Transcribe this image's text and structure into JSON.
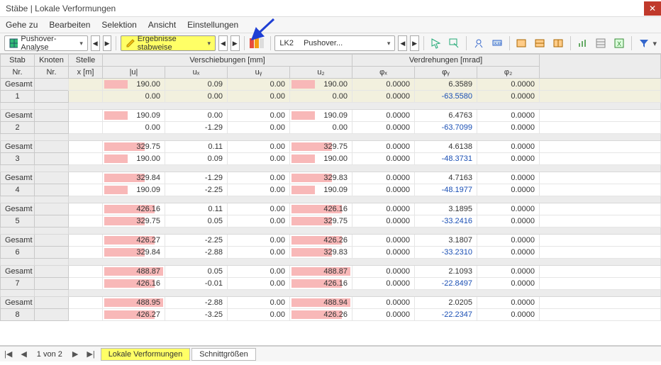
{
  "window": {
    "title": "Stäbe | Lokale Verformungen"
  },
  "menu": {
    "items": [
      "Gehe zu",
      "Bearbeiten",
      "Selektion",
      "Ansicht",
      "Einstellungen"
    ]
  },
  "toolbar": {
    "analysis": "Pushover-Analyse",
    "results": "Ergebnisse stabweise",
    "lc_code": "LK2",
    "lc_name": "Pushover..."
  },
  "headers": {
    "stab": "Stab",
    "nr": "Nr.",
    "knoten": "Knoten",
    "stelle": "Stelle",
    "x": "x [m]",
    "versch": "Verschiebungen [mm]",
    "verdr": "Verdrehungen [mrad]",
    "u": "|u|",
    "ux": "uₓ",
    "uy": "uᵧ",
    "uz": "u₂",
    "phix": "φₓ",
    "phiy": "φᵧ",
    "phiz": "φ₂"
  },
  "labels": {
    "gesamt": "Gesamt"
  },
  "rows": [
    {
      "id": "1",
      "g": {
        "u": "190.00",
        "ux": "0.09",
        "uy": "0.00",
        "uz": "190.00",
        "px": "0.0000",
        "py": "6.3589",
        "pz": "0.0000",
        "bu": 38,
        "bz": 38
      },
      "r": {
        "u": "0.00",
        "ux": "0.00",
        "uy": "0.00",
        "uz": "0.00",
        "px": "0.0000",
        "py": "-63.5580",
        "pz": "0.0000",
        "bu": 0,
        "bz": 0
      }
    },
    {
      "id": "2",
      "g": {
        "u": "190.09",
        "ux": "0.00",
        "uy": "0.00",
        "uz": "190.09",
        "px": "0.0000",
        "py": "6.4763",
        "pz": "0.0000",
        "bu": 38,
        "bz": 38
      },
      "r": {
        "u": "0.00",
        "ux": "-1.29",
        "uy": "0.00",
        "uz": "0.00",
        "px": "0.0000",
        "py": "-63.7099",
        "pz": "0.0000",
        "bu": 0,
        "bz": 0
      }
    },
    {
      "id": "3",
      "g": {
        "u": "329.75",
        "ux": "0.11",
        "uy": "0.00",
        "uz": "329.75",
        "px": "0.0000",
        "py": "4.6138",
        "pz": "0.0000",
        "bu": 65,
        "bz": 65
      },
      "r": {
        "u": "190.00",
        "ux": "0.09",
        "uy": "0.00",
        "uz": "190.00",
        "px": "0.0000",
        "py": "-48.3731",
        "pz": "0.0000",
        "bu": 38,
        "bz": 38
      }
    },
    {
      "id": "4",
      "g": {
        "u": "329.84",
        "ux": "-1.29",
        "uy": "0.00",
        "uz": "329.83",
        "px": "0.0000",
        "py": "4.7163",
        "pz": "0.0000",
        "bu": 65,
        "bz": 65
      },
      "r": {
        "u": "190.09",
        "ux": "-2.25",
        "uy": "0.00",
        "uz": "190.09",
        "px": "0.0000",
        "py": "-48.1977",
        "pz": "0.0000",
        "bu": 38,
        "bz": 38
      }
    },
    {
      "id": "5",
      "g": {
        "u": "426.16",
        "ux": "0.11",
        "uy": "0.00",
        "uz": "426.16",
        "px": "0.0000",
        "py": "3.1895",
        "pz": "0.0000",
        "bu": 82,
        "bz": 82
      },
      "r": {
        "u": "329.75",
        "ux": "0.05",
        "uy": "0.00",
        "uz": "329.75",
        "px": "0.0000",
        "py": "-33.2416",
        "pz": "0.0000",
        "bu": 65,
        "bz": 65
      }
    },
    {
      "id": "6",
      "g": {
        "u": "426.27",
        "ux": "-2.25",
        "uy": "0.00",
        "uz": "426.26",
        "px": "0.0000",
        "py": "3.1807",
        "pz": "0.0000",
        "bu": 82,
        "bz": 82
      },
      "r": {
        "u": "329.84",
        "ux": "-2.88",
        "uy": "0.00",
        "uz": "329.83",
        "px": "0.0000",
        "py": "-33.2310",
        "pz": "0.0000",
        "bu": 65,
        "bz": 65
      }
    },
    {
      "id": "7",
      "g": {
        "u": "488.87",
        "ux": "0.05",
        "uy": "0.00",
        "uz": "488.87",
        "px": "0.0000",
        "py": "2.1093",
        "pz": "0.0000",
        "bu": 95,
        "bz": 95
      },
      "r": {
        "u": "426.16",
        "ux": "-0.01",
        "uy": "0.00",
        "uz": "426.16",
        "px": "0.0000",
        "py": "-22.8497",
        "pz": "0.0000",
        "bu": 82,
        "bz": 82
      }
    },
    {
      "id": "8",
      "g": {
        "u": "488.95",
        "ux": "-2.88",
        "uy": "0.00",
        "uz": "488.94",
        "px": "0.0000",
        "py": "2.0205",
        "pz": "0.0000",
        "bu": 95,
        "bz": 95
      },
      "r": {
        "u": "426.27",
        "ux": "-3.25",
        "uy": "0.00",
        "uz": "426.26",
        "px": "0.0000",
        "py": "-22.2347",
        "pz": "0.0000",
        "bu": 82,
        "bz": 82
      }
    }
  ],
  "footer": {
    "page": "1 von 2",
    "tabs": [
      "Lokale Verformungen",
      "Schnittgrößen"
    ]
  }
}
